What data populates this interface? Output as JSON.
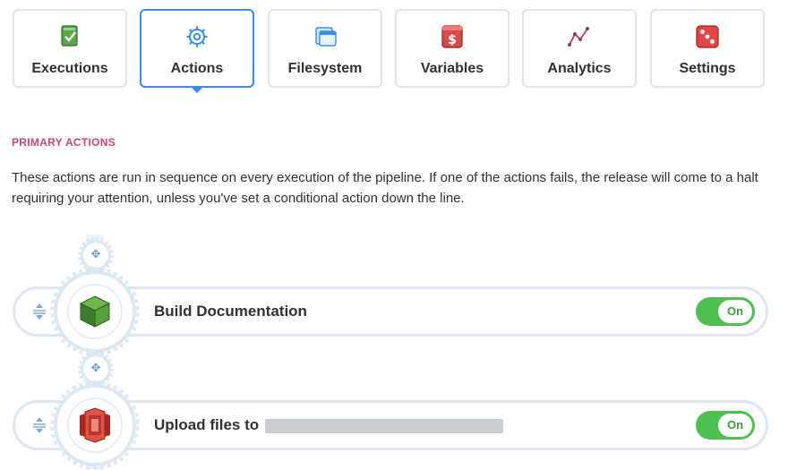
{
  "tabs": [
    {
      "label": "Executions",
      "icon": "execution-check-icon"
    },
    {
      "label": "Actions",
      "icon": "gear-icon",
      "active": true
    },
    {
      "label": "Filesystem",
      "icon": "folder-icon"
    },
    {
      "label": "Variables",
      "icon": "dollar-icon"
    },
    {
      "label": "Analytics",
      "icon": "line-chart-icon"
    },
    {
      "label": "Settings",
      "icon": "dice-icon"
    }
  ],
  "section": {
    "label": "PRIMARY ACTIONS",
    "description": "These actions are run in sequence on every execution of the pipeline. If one of the actions fails, the release will come to a halt requiring your attention, unless you've set a conditional action down the line."
  },
  "actions": [
    {
      "title": "Build Documentation",
      "icon": "cube-icon",
      "toggle": "On"
    },
    {
      "title": "Upload files to",
      "icon": "s3-bucket-icon",
      "toggle": "On"
    }
  ],
  "colors": {
    "accent": "#3a8ee6",
    "section_label": "#c6486a",
    "toggle_on": "#4fbf52",
    "border": "#dbe7f3"
  }
}
